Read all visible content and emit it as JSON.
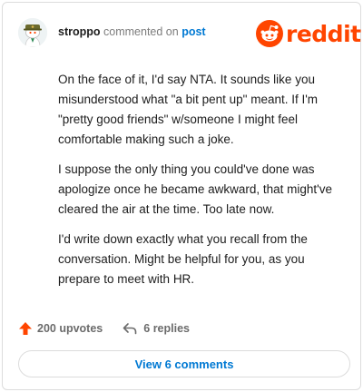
{
  "header": {
    "username": "stroppo",
    "action_text": "commented on",
    "post_link": "post"
  },
  "brand": {
    "wordmark": "reddit",
    "icon": "reddit-alien-logo",
    "color": "#ff4500"
  },
  "comment": {
    "paragraphs": [
      "On the face of it, I'd say NTA. It sounds like you misunderstood what \"a bit pent up\" meant. If I'm \"pretty good friends\" w/someone I might feel comfortable making such a joke.",
      "I suppose the only thing you could've done was apologize once he became awkward, that might've cleared the air at the time. Too late now.",
      "I'd write down exactly what you recall from the conversation. Might be helpful for you, as you prepare to meet with HR."
    ]
  },
  "actions": {
    "upvotes": "200 upvotes",
    "replies": "6 replies",
    "upvote_icon": "upvote-arrow-icon",
    "reply_icon": "reply-arrow-icon"
  },
  "footer": {
    "view_comments": "View 6 comments"
  }
}
